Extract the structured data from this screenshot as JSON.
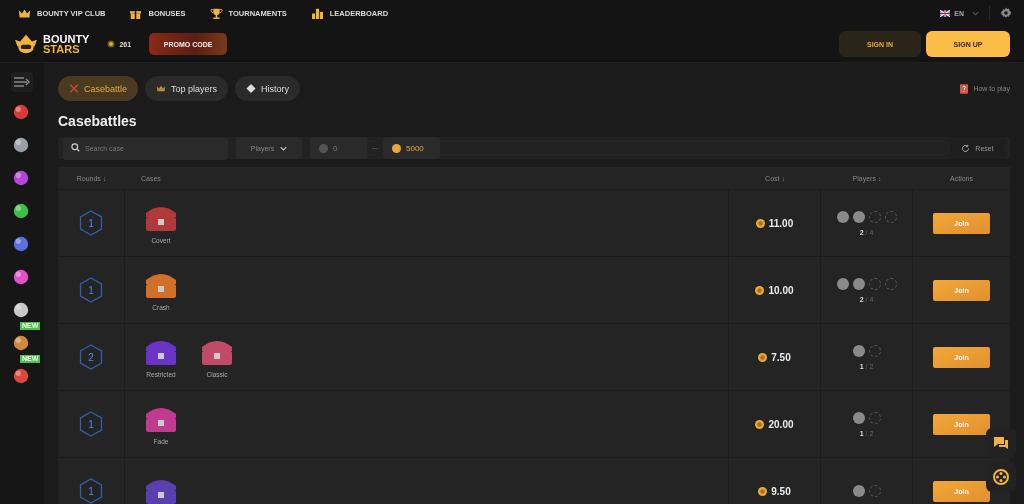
{
  "top_nav": [
    {
      "kind": "crown",
      "label": "BOUNTY VIP CLUB"
    },
    {
      "kind": "gift",
      "label": "BONUSES"
    },
    {
      "kind": "trophy",
      "label": "TOURNAMENTS"
    },
    {
      "kind": "bars",
      "label": "LEADERBOARD"
    }
  ],
  "language": "EN",
  "header": {
    "logo_top": "BOUNTY",
    "logo_bottom": "STARS",
    "balance": "261",
    "promo": "PROMO CODE",
    "sign_in": "SIGN IN",
    "sign_up": "SIGN UP"
  },
  "sidebar": {
    "items": [
      {
        "color": "#d83a3a"
      },
      {
        "color": "#9aa0a8"
      },
      {
        "color": "#b646d8"
      },
      {
        "color": "#3fbf4a"
      },
      {
        "color": "#5a6fe0"
      },
      {
        "color": "#e052c8"
      },
      {
        "color": "#c8c8c8"
      },
      {
        "color": "#d08a3a",
        "badge": "NEW"
      },
      {
        "color": "#d84a3a",
        "badge": "NEW"
      }
    ]
  },
  "tabs": [
    {
      "kind": "swords",
      "label": "Casebattle",
      "selected": true
    },
    {
      "kind": "crown",
      "label": "Top players",
      "selected": false
    },
    {
      "kind": "ticket",
      "label": "History",
      "selected": false
    }
  ],
  "how_to_play": "How to play",
  "title": "Casebattles",
  "filters": {
    "search_placeholder": "Search case",
    "players": "Players",
    "min": "0",
    "max": "5000",
    "reset": "Reset"
  },
  "table": {
    "columns": [
      "Rounds ↓",
      "Cases",
      "Cost ↓",
      "Players ↓",
      "Actions"
    ],
    "rows": [
      {
        "rounds": "1",
        "cases": [
          {
            "name": "Covert",
            "color": "#b03a3a"
          }
        ],
        "cost": "11.00",
        "avatars": [
          {
            "filled": true
          },
          {
            "filled": true
          },
          {
            "filled": false
          },
          {
            "filled": false
          }
        ],
        "count": "**2** / 4",
        "action": "Join"
      },
      {
        "rounds": "1",
        "cases": [
          {
            "name": "Crash",
            "color": "#d0702a"
          }
        ],
        "cost": "10.00",
        "avatars": [
          {
            "filled": true
          },
          {
            "filled": true
          },
          {
            "filled": false
          },
          {
            "filled": false
          }
        ],
        "count": "**2** / 4",
        "action": "Join"
      },
      {
        "rounds": "2",
        "cases": [
          {
            "name": "Restricted",
            "color": "#6a34c8"
          },
          {
            "name": "Classic",
            "color": "#c04a6a"
          }
        ],
        "cost": "7.50",
        "avatars": [
          {
            "filled": true
          },
          {
            "filled": false
          }
        ],
        "count": "**1** / 2",
        "action": "Join"
      },
      {
        "rounds": "1",
        "cases": [
          {
            "name": "Fade",
            "color": "#c03a90"
          }
        ],
        "cost": "20.00",
        "avatars": [
          {
            "filled": true
          },
          {
            "filled": false
          }
        ],
        "count": "**1** / 2",
        "action": "Join"
      },
      {
        "rounds": "1",
        "cases": [
          {
            "color": "#5a3fb0"
          }
        ],
        "cost": "9.50",
        "avatars": [
          {
            "filled": true
          },
          {
            "filled": false
          }
        ],
        "action": "Join"
      }
    ]
  }
}
